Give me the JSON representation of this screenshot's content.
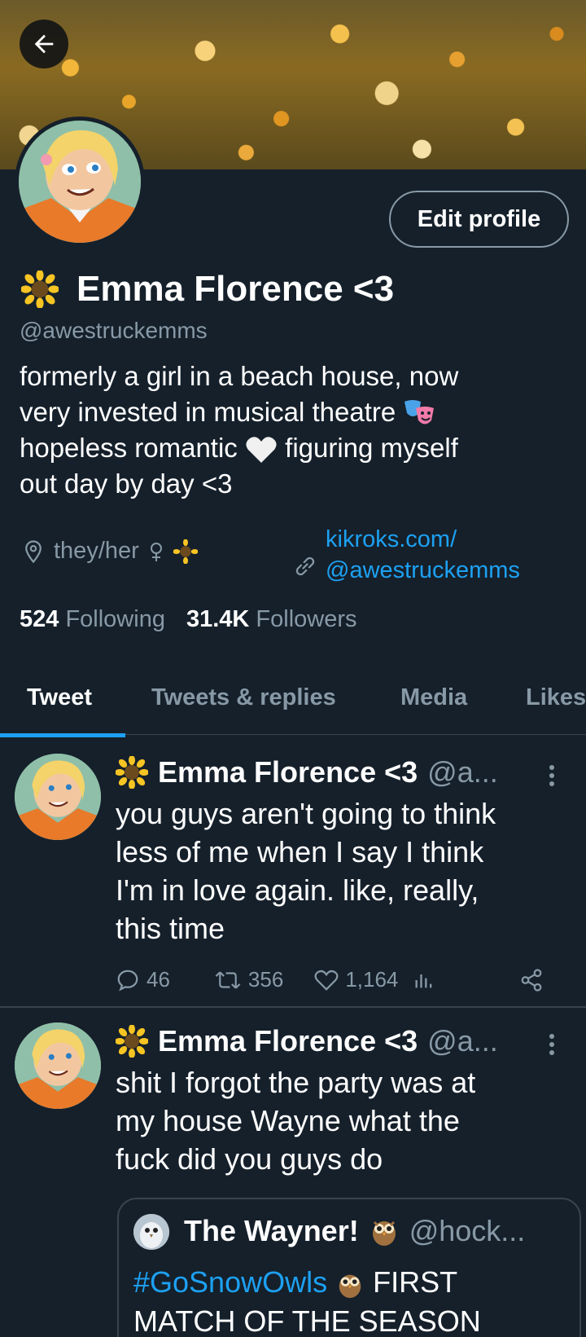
{
  "profile": {
    "name": "Emma Florence <3",
    "handle": "@awestruckemms",
    "edit_label": "Edit profile",
    "bio_line1": "formerly a girl in a beach house, now",
    "bio_line2": "very invested in musical theatre",
    "bio_line3a": "hopeless romantic",
    "bio_line3b": "figuring myself",
    "bio_line4": "out day by day <3",
    "location": "they/her",
    "link_line1": "kikroks.com/",
    "link_line2": "@awestruckemms",
    "following_count": "524",
    "following_label": "Following",
    "followers_count": "31.4K",
    "followers_label": "Followers"
  },
  "tabs": [
    "Tweet",
    "Tweets & replies",
    "Media",
    "Likes"
  ],
  "tweets": [
    {
      "name": "Emma Florence <3",
      "handle": "@a...",
      "line1": "you guys aren't going to think",
      "line2": "less of me when I say I think",
      "line3": "I'm in love again. like, really,",
      "line4": "this time",
      "replies": "46",
      "retweets": "356",
      "likes": "1,164"
    },
    {
      "name": "Emma Florence <3",
      "handle": "@a...",
      "line1": "shit I forgot the party was at",
      "line2": "my house Wayne what the",
      "line3": "fuck did you guys do"
    }
  ],
  "quote": {
    "name": "The Wayner!",
    "handle": "@hock...",
    "hashtag": "#GoSnowOwls",
    "text_a": "FIRST",
    "text_b": "MATCH OF THE SEASON"
  },
  "colors": {
    "background": "#15202b",
    "accent": "#1da1f2",
    "muted": "#8899a6",
    "divider": "#38444d"
  }
}
